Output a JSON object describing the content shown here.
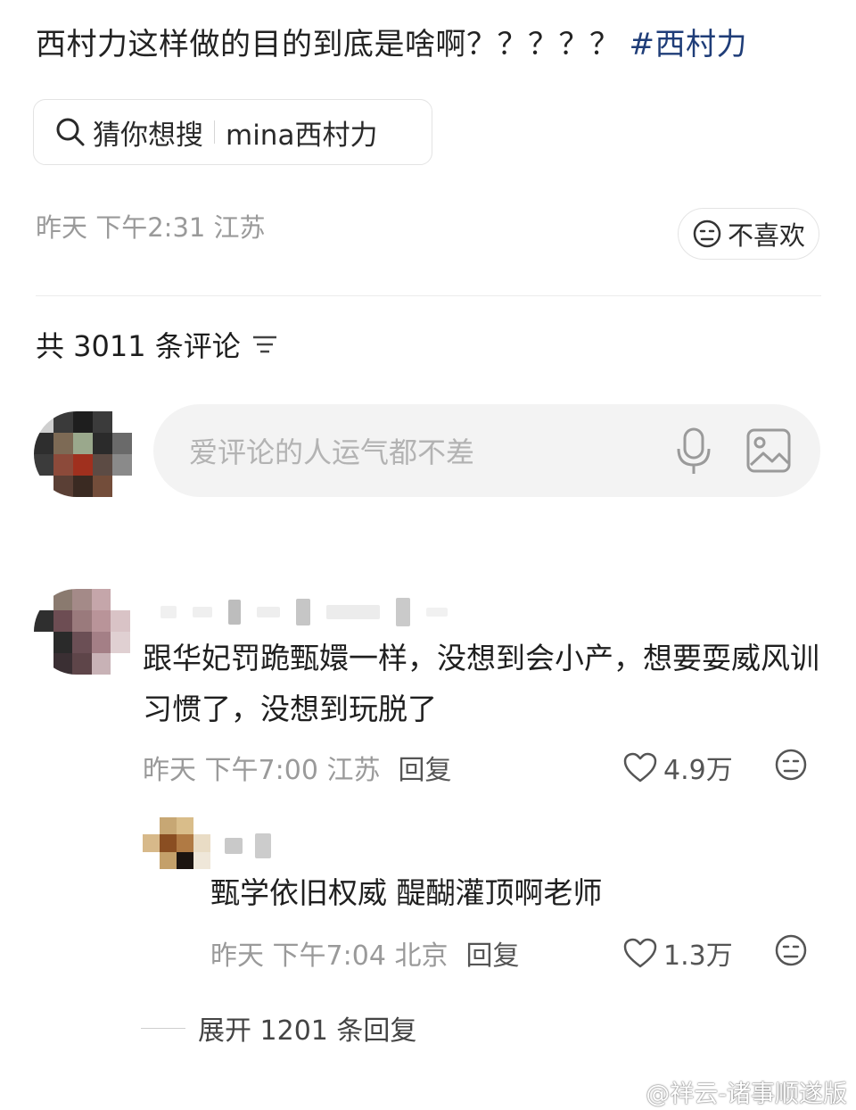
{
  "post": {
    "title": "西村力这样做的目的到底是啥啊？？？？？",
    "hashtag": "#西村力",
    "search_chip": {
      "prefix": "猜你想搜",
      "query": "mina西村力"
    },
    "meta": "昨天 下午2:31 江苏",
    "dislike_label": "不喜欢"
  },
  "comments_section": {
    "count_label": "共 3011 条评论",
    "input_placeholder": "爱评论的人运气都不差"
  },
  "comments": [
    {
      "text": "跟华妃罚跪甄嬛一样，没想到会小产，想要耍威风训习惯了，没想到玩脱了",
      "meta": "昨天 下午7:00 江苏",
      "reply_label": "回复",
      "likes": "4.9万"
    }
  ],
  "replies": [
    {
      "text": "甄学依旧权威 醍醐灌顶啊老师",
      "meta": "昨天 下午7:04 北京",
      "reply_label": "回复",
      "likes": "1.3万"
    }
  ],
  "expand_label": "展开 1201 条回复",
  "watermark": "@祥云-诸事顺遂版",
  "colors": {
    "hashtag": "#1f3d78",
    "meta_gray": "#9a9a9a",
    "input_bg": "#f3f3f3"
  },
  "icons": [
    "search-icon",
    "dislike-face-icon",
    "sort-icon",
    "microphone-icon",
    "image-icon",
    "heart-icon",
    "weibo-logo-icon"
  ]
}
